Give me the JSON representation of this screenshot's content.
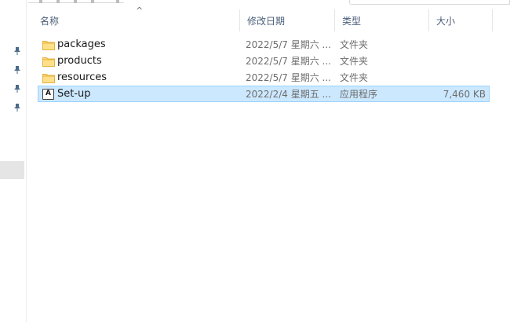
{
  "columns": {
    "name": "名称",
    "date_modified": "修改日期",
    "type": "类型",
    "size": "大小",
    "sort_indicator": "^"
  },
  "files": [
    {
      "name": "packages",
      "date": "2022/5/7 星期六 ...",
      "type": "文件夹",
      "size": "",
      "icon": "folder-icon",
      "selected": false
    },
    {
      "name": "products",
      "date": "2022/5/7 星期六 ...",
      "type": "文件夹",
      "size": "",
      "icon": "folder-icon",
      "selected": false
    },
    {
      "name": "resources",
      "date": "2022/5/7 星期六 ...",
      "type": "文件夹",
      "size": "",
      "icon": "folder-icon",
      "selected": false
    },
    {
      "name": "Set-up",
      "date": "2022/2/4 星期五 ...",
      "type": "应用程序",
      "size": "7,460 KB",
      "icon": "application-icon",
      "selected": true
    }
  ],
  "nav_pane": {
    "pins": [
      "pin-icon",
      "pin-icon",
      "pin-icon",
      "pin-icon"
    ]
  },
  "colors": {
    "selection_fill": "#cce8ff",
    "selection_border": "#99d1ff",
    "header_text": "#4c607a",
    "folder_yellow": "#f8d775"
  }
}
